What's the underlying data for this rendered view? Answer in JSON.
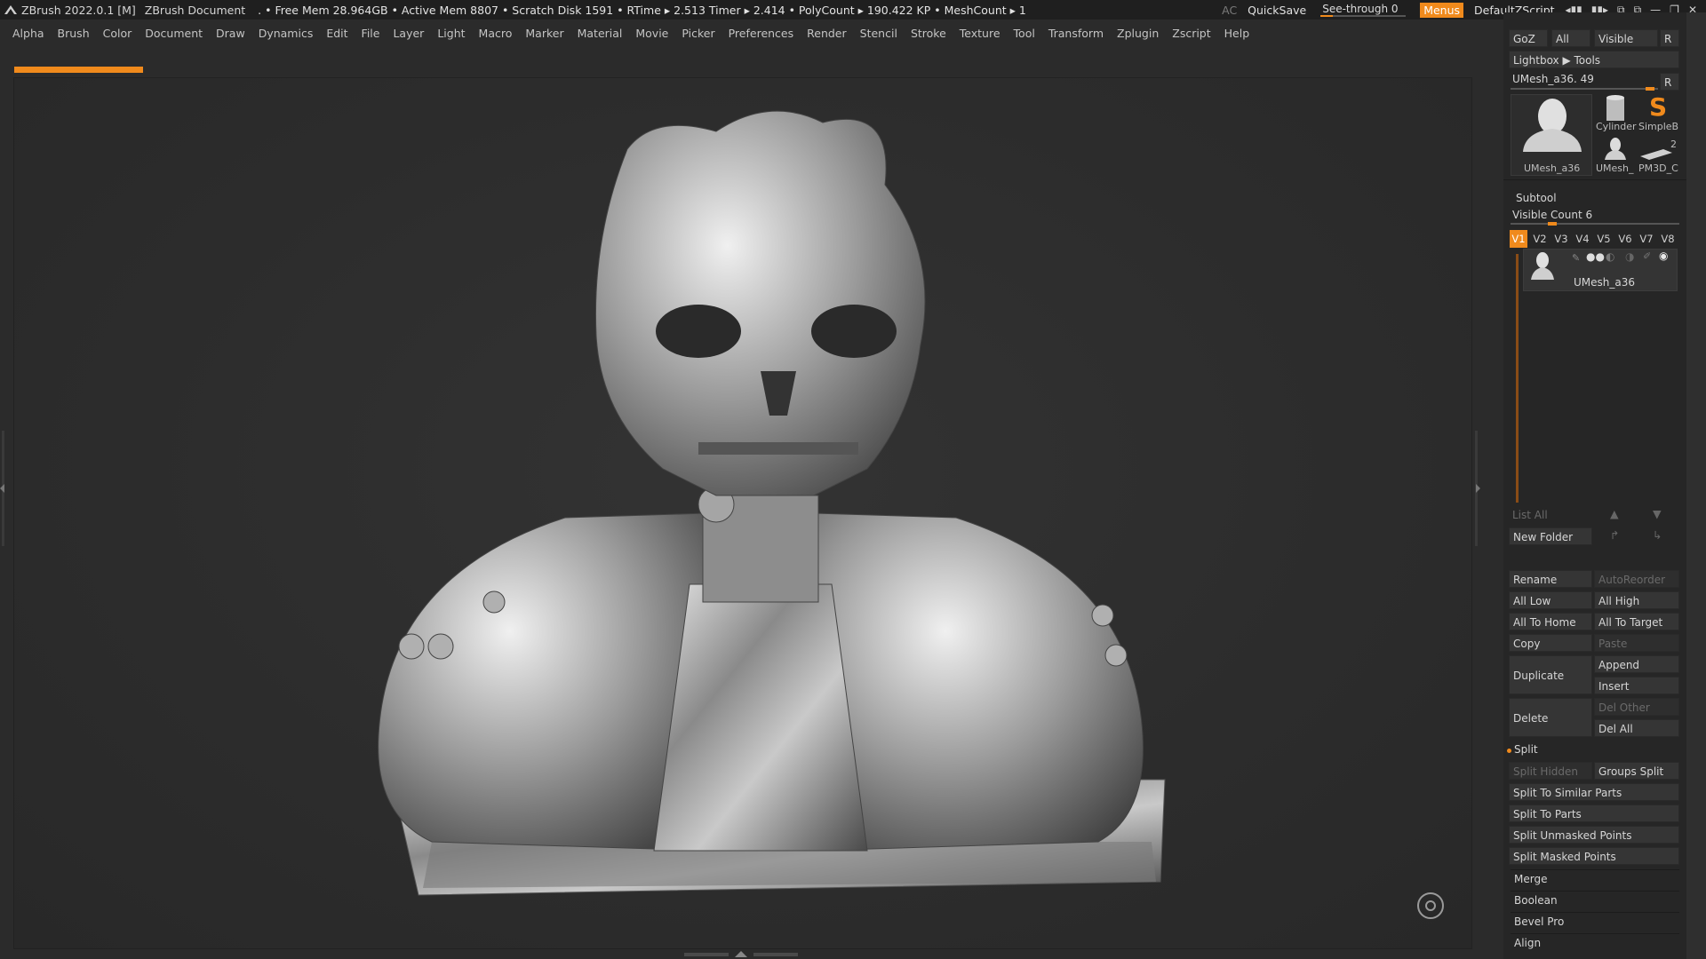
{
  "titlebar": {
    "app_title": "ZBrush 2022.0.1 [M]",
    "document": "ZBrush Document",
    "stats": ". • Free Mem 28.964GB • Active Mem 8807 • Scratch Disk 1591 •  RTime ▸ 2.513 Timer ▸ 2.414 • PolyCount ▸ 190.422 KP  • MeshCount ▸ 1",
    "ac": "AC",
    "quicksave": "QuickSave",
    "see_through_label": "See-through  0",
    "menus": "Menus",
    "script": "DefaultZScript"
  },
  "menubar": [
    "Alpha",
    "Brush",
    "Color",
    "Document",
    "Draw",
    "Dynamics",
    "Edit",
    "File",
    "Layer",
    "Light",
    "Macro",
    "Marker",
    "Material",
    "Movie",
    "Picker",
    "Preferences",
    "Render",
    "Stencil",
    "Stroke",
    "Texture",
    "Tool",
    "Transform",
    "Zplugin",
    "Zscript",
    "Help"
  ],
  "tool_panel": {
    "goz": "GoZ",
    "all": "All",
    "visible": "Visible",
    "r": "R",
    "lightbox_tools": "Lightbox ▶ Tools",
    "current_tool": "UMesh_a36. 49",
    "thumbs": {
      "main": "UMesh_a36",
      "cylinder": "Cylinder",
      "simpleb": "SimpleB",
      "umesh_small": "UMesh_",
      "pm3d": "PM3D_C",
      "pm3d_count": "2"
    }
  },
  "subtool": {
    "header": "Subtool",
    "visible_count": "Visible Count 6",
    "visible_count_value": 6,
    "tabs": [
      "V1",
      "V2",
      "V3",
      "V4",
      "V5",
      "V6",
      "V7",
      "V8"
    ],
    "item_name": "UMesh_a36",
    "list_all": "List All",
    "new_folder": "New Folder",
    "rename": "Rename",
    "autoreorder": "AutoReorder",
    "all_low": "All Low",
    "all_high": "All High",
    "all_to_home": "All To Home",
    "all_to_target": "All To Target",
    "copy": "Copy",
    "paste": "Paste",
    "duplicate": "Duplicate",
    "append": "Append",
    "insert": "Insert",
    "delete": "Delete",
    "del_other": "Del Other",
    "del_all": "Del All",
    "split": "Split",
    "split_hidden": "Split Hidden",
    "groups_split": "Groups Split",
    "split_similar": "Split To Similar Parts",
    "split_parts": "Split To Parts",
    "split_unmasked": "Split Unmasked Points",
    "split_masked": "Split Masked Points",
    "merge": "Merge",
    "boolean": "Boolean",
    "bevel_pro": "Bevel Pro",
    "align": "Align"
  },
  "colors": {
    "accent": "#f08a1c",
    "background": "#2b2b2b",
    "panel": "#262626"
  }
}
